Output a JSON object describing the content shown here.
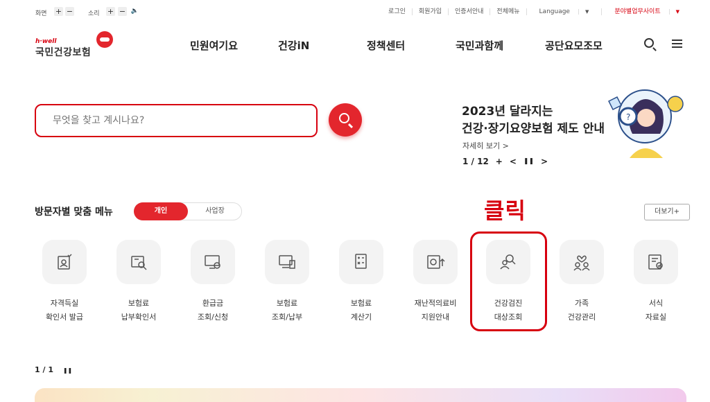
{
  "utility": {
    "screen_label": "화면",
    "sound_label": "소리",
    "plus": "+",
    "minus": "−",
    "speaker": "🔈",
    "links": [
      "로그인",
      "회원가입",
      "인증서안내",
      "전체메뉴",
      "Language",
      "분야별업무사이트"
    ]
  },
  "logo": {
    "small": "h·well",
    "main": "국민건강보험"
  },
  "nav": [
    "민원여기요",
    "건강iN",
    "정책센터",
    "국민과함께",
    "공단요모조모"
  ],
  "search": {
    "placeholder": "무엇을 찾고 계시나요?"
  },
  "banner": {
    "line1": "2023년 달라지는",
    "line2": "건강·장기요양보험 제도 안내",
    "more": "자세히 보기 >",
    "page": "1 / 12",
    "plus": "+",
    "prev": "<",
    "pause": "❚❚",
    "next": ">"
  },
  "menu": {
    "title": "방문자별 맞춤 메뉴",
    "tab_personal": "개인",
    "tab_business": "사업장",
    "more": "더보기+",
    "annotation": "클릭",
    "items": [
      {
        "l1": "자격득실",
        "l2": "확인서 발급"
      },
      {
        "l1": "보험료",
        "l2": "납부확인서"
      },
      {
        "l1": "환급금",
        "l2": "조회/신청"
      },
      {
        "l1": "보험료",
        "l2": "조회/납부"
      },
      {
        "l1": "보험료",
        "l2": "계산기"
      },
      {
        "l1": "재난적의료비",
        "l2": "지원안내"
      },
      {
        "l1": "건강검진",
        "l2": "대상조회"
      },
      {
        "l1": "가족",
        "l2": "건강관리"
      },
      {
        "l1": "서식",
        "l2": "자료실"
      }
    ]
  },
  "bottom_pager": {
    "page": "1 / 1",
    "pause": "❚❚"
  },
  "colors": {
    "accent": "#d7000f",
    "tile_bg": "#f3f3f3"
  }
}
